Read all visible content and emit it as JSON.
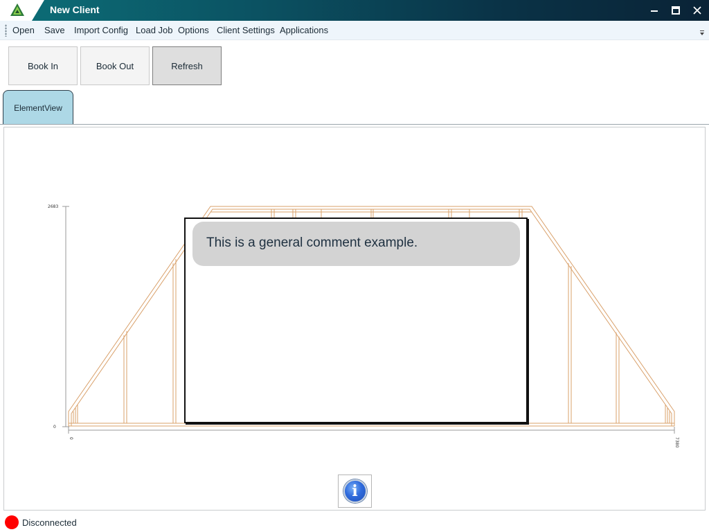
{
  "window": {
    "title": "New Client"
  },
  "window_controls": {
    "minimize": "—",
    "maximize": "□",
    "close": "✕"
  },
  "menu": [
    "Open",
    "Save",
    "Import Config",
    "Load Job",
    "Options",
    "Client Settings",
    "Applications"
  ],
  "toolbar": {
    "book_in": "Book In",
    "book_out": "Book Out",
    "refresh": "Refresh"
  },
  "tabs": [
    {
      "label": "ElementView",
      "selected": true
    }
  ],
  "drawing": {
    "y_axis_top_label": "2683",
    "y_axis_bottom_label": "0",
    "x_axis_left_label": "0",
    "x_axis_right_label": "7380",
    "frame_color": "#d9a06a"
  },
  "comment": {
    "text": "This is a general comment example."
  },
  "icons": {
    "app": "truss-logo-icon",
    "info": "info-icon"
  },
  "status": {
    "text": "Disconnected",
    "color": "#ff0000"
  }
}
